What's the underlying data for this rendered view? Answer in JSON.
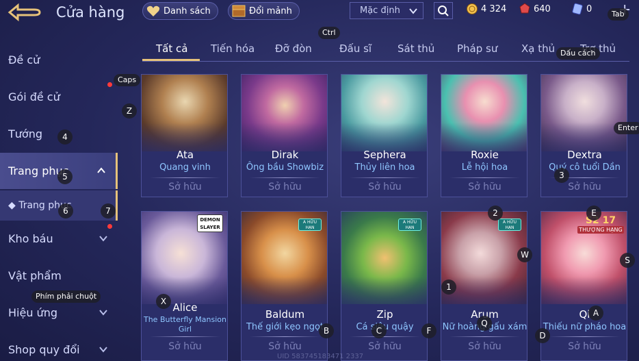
{
  "header": {
    "title": "Cửa hàng",
    "collection_label": "Danh sách",
    "exchange_label": "Đổi mảnh",
    "sort": {
      "selected": "Mặc định"
    },
    "currencies": [
      {
        "icon": "gold-coin-icon",
        "value": "4 324"
      },
      {
        "icon": "ruby-icon",
        "value": "640"
      },
      {
        "icon": "voucher-icon",
        "value": "0"
      }
    ]
  },
  "hints": {
    "tab": "Tab",
    "ctrl": "Ctrl",
    "space": "Dấu cách",
    "caps": "Caps",
    "enter": "Enter",
    "right_mouse": "Phím phải chuột",
    "z": "Z",
    "four": "4",
    "five": "5",
    "six": "6",
    "seven": "7",
    "three": "3",
    "two": "2",
    "e": "E",
    "w": "W",
    "s": "S",
    "one": "1",
    "x": "X",
    "c": "C",
    "f": "F",
    "q": "Q",
    "a": "A",
    "d": "D",
    "b": "B"
  },
  "sidebar": {
    "items": [
      {
        "label": "Đề cử"
      },
      {
        "label": "Gói đề cử"
      },
      {
        "label": "Tướng"
      },
      {
        "label": "Trang phục"
      },
      {
        "label": "◆ Trang phục"
      },
      {
        "label": "Kho báu"
      },
      {
        "label": "Vật phẩm"
      },
      {
        "label": "Hiệu ứng"
      },
      {
        "label": "Shop quy đổi"
      }
    ]
  },
  "tabs": [
    {
      "label": "Tất cả"
    },
    {
      "label": "Tiến hóa"
    },
    {
      "label": "Đỡ đòn"
    },
    {
      "label": "Đấu sĩ"
    },
    {
      "label": "Sát thủ"
    },
    {
      "label": "Pháp sư"
    },
    {
      "label": "Xạ thủ"
    },
    {
      "label": "Trợ thủ"
    }
  ],
  "cards": [
    {
      "hero": "Ata",
      "skin": "Quang vinh",
      "status": "Sở hữu"
    },
    {
      "hero": "Dirak",
      "skin": "Ông bầu Showbiz",
      "status": "Sở hữu"
    },
    {
      "hero": "Sephera",
      "skin": "Thủy liên hoa",
      "status": "Sở hữu"
    },
    {
      "hero": "Roxie",
      "skin": "Lễ hội hoa",
      "status": "Sở hữu"
    },
    {
      "hero": "Dextra",
      "skin": "Quý cô tuổi Dần",
      "status": "Sở hữu"
    },
    {
      "hero": "Alice",
      "skin": "The Butterfly Mansion Girl",
      "status": "Sở hữu",
      "logo": "DEMON SLAYER"
    },
    {
      "hero": "Baldum",
      "skin": "Thế giới kẹo ngọt",
      "status": "Sở hữu",
      "tag": "A HỮU HẠN"
    },
    {
      "hero": "Zip",
      "skin": "Cá siêu quậy",
      "status": "Sở hữu",
      "tag": "A HỮU HẠN"
    },
    {
      "hero": "Arum",
      "skin": "Nữ hoàng gấu xám",
      "status": "Sở hữu",
      "tag": "A HỮU HẠN"
    },
    {
      "hero": "Qi",
      "skin": "Thiếu nữ pháo hoa",
      "status": "Sở hữu",
      "logo": "S2 17",
      "logo_caption": "THƯỢNG HẠNG"
    }
  ],
  "footer": {
    "uid": "UID 583745183471 2337"
  },
  "colors": {
    "accent": "#e6c27a",
    "skin_name": "#8fc6ff",
    "background": "#2a2d62"
  }
}
